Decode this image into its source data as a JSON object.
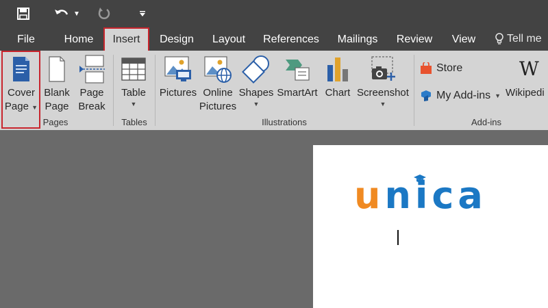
{
  "colors": {
    "titlebar": "#434343",
    "ribbon": "#d4d4d4",
    "highlight": "#c8242c",
    "workspace": "#6a6a6a",
    "logo_orange": "#f08a22",
    "logo_blue": "#1b78c4"
  },
  "quick_access": {
    "icons": [
      "save-icon",
      "undo-icon",
      "undo-dropdown-icon",
      "redo-icon",
      "customize-qat-icon"
    ]
  },
  "tabs": [
    {
      "label": "File"
    },
    {
      "label": "Home"
    },
    {
      "label": "Insert",
      "active": true
    },
    {
      "label": "Design"
    },
    {
      "label": "Layout"
    },
    {
      "label": "References"
    },
    {
      "label": "Mailings"
    },
    {
      "label": "Review"
    },
    {
      "label": "View"
    }
  ],
  "tell_me": {
    "label": "Tell me"
  },
  "ribbon": {
    "pages": {
      "label": "Pages",
      "cover_page": {
        "line1": "Cover",
        "line2": "Page"
      },
      "blank_page": {
        "line1": "Blank",
        "line2": "Page"
      },
      "page_break": {
        "line1": "Page",
        "line2": "Break"
      }
    },
    "tables": {
      "label": "Tables",
      "table": {
        "line1": "Table"
      }
    },
    "illustrations": {
      "label": "Illustrations",
      "pictures": {
        "line1": "Pictures"
      },
      "online_pictures": {
        "line1": "Online",
        "line2": "Pictures"
      },
      "shapes": {
        "line1": "Shapes"
      },
      "smartart": {
        "line1": "SmartArt"
      },
      "chart": {
        "line1": "Chart"
      },
      "screenshot": {
        "line1": "Screenshot"
      }
    },
    "addins": {
      "label": "Add-ins",
      "store": "Store",
      "my_addins": "My Add-ins",
      "wikipedia": "Wikipedi"
    }
  },
  "document": {
    "logo_u": "u",
    "logo_rest": "nica"
  }
}
